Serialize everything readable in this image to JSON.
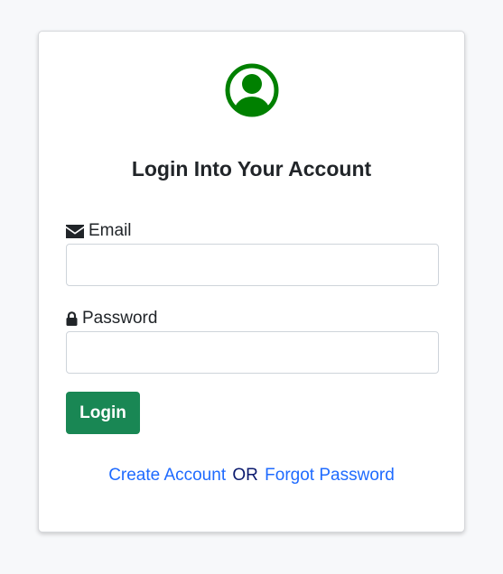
{
  "icons": {
    "avatar": "user-circle-icon",
    "email": "envelope-icon",
    "password": "lock-icon"
  },
  "colors": {
    "avatar": "#008000",
    "login_button": "#198754",
    "link": "#1f6bff",
    "separator_text": "#0b1a6e"
  },
  "login_form": {
    "title": "Login Into Your Account",
    "email": {
      "label": "Email",
      "value": ""
    },
    "password": {
      "label": "Password",
      "value": ""
    },
    "login_button": "Login"
  },
  "links": {
    "create_account": "Create Account",
    "separator": "OR",
    "forgot_password": "Forgot Password"
  }
}
